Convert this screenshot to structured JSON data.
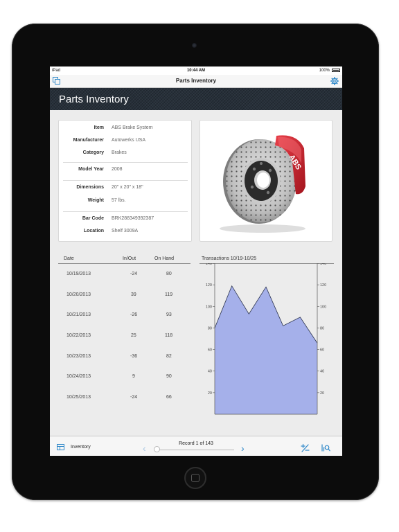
{
  "status": {
    "carrier": "iPad",
    "time": "10:44 AM",
    "battery": "100%"
  },
  "nav": {
    "title": "Parts Inventory"
  },
  "header": {
    "title": "Parts Inventory"
  },
  "details": [
    {
      "label": "Item",
      "value": "ABS Brake System"
    },
    {
      "label": "Manufacturer",
      "value": "Autowerks USA"
    },
    {
      "label": "Category",
      "value": "Brakes"
    },
    {
      "label": "Model Year",
      "value": "2008"
    },
    {
      "label": "Dimensions",
      "value": "20\" x 20\" x 18\""
    },
    {
      "label": "Weight",
      "value": "57 lbs."
    },
    {
      "label": "Bar Code",
      "value": "BRK288349392387"
    },
    {
      "label": "Location",
      "value": "Shelf 3009A"
    }
  ],
  "photo": {
    "caliper_text": "ABS"
  },
  "transactions": {
    "columns": [
      "Date",
      "In/Out",
      "On Hand"
    ],
    "rows": [
      [
        "10/19/2013",
        "-24",
        "80"
      ],
      [
        "10/20/2013",
        "39",
        "119"
      ],
      [
        "10/21/2013",
        "-26",
        "93"
      ],
      [
        "10/22/2013",
        "25",
        "118"
      ],
      [
        "10/23/2013",
        "-36",
        "82"
      ],
      [
        "10/24/2013",
        "9",
        "90"
      ],
      [
        "10/25/2013",
        "-24",
        "66"
      ]
    ]
  },
  "chart_data": {
    "type": "area",
    "title": "Transactions 10/19-10/25",
    "x": [
      "10/19/2013",
      "10/20/2013",
      "10/21/2013",
      "10/22/2013",
      "10/23/2013",
      "10/24/2013",
      "10/25/2013"
    ],
    "series": [
      {
        "values": [
          80,
          119,
          93,
          118,
          82,
          90,
          66
        ]
      }
    ],
    "yticks": [
      20,
      40,
      60,
      80,
      100,
      120,
      140
    ],
    "ylim": [
      0,
      140
    ],
    "fill_color": "#a5b0ea",
    "line_color": "#2d3550",
    "grid": false
  },
  "toolbar": {
    "left_label": "Inventory",
    "record": "Record 1 of 143",
    "prev": "‹",
    "next": "›",
    "accent": "#2e88c9",
    "slider_position": 0
  }
}
